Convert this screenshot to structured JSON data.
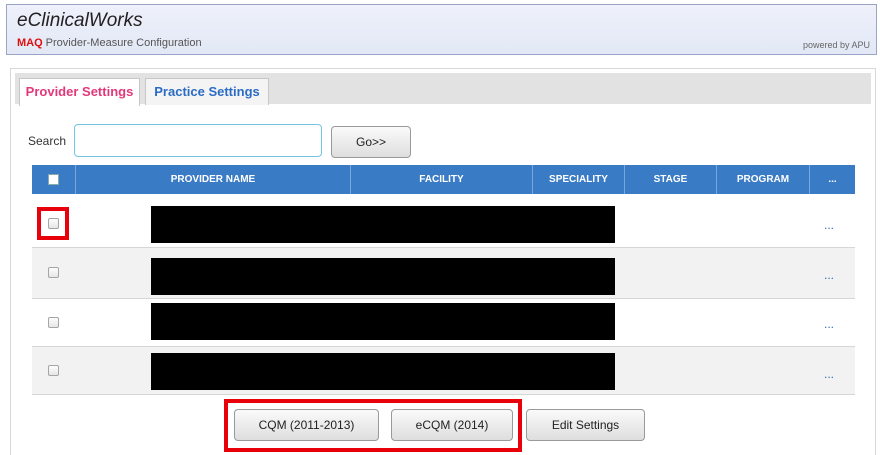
{
  "header": {
    "app_title": "eClinicalWorks",
    "subtitle_prefix": "MAQ",
    "subtitle": "Provider-Measure Configuration",
    "powered_by": "powered by APU"
  },
  "tabs": [
    {
      "label": "Provider Settings",
      "active": true
    },
    {
      "label": "Practice Settings",
      "active": false
    }
  ],
  "search": {
    "label": "Search",
    "value": "",
    "placeholder": "",
    "go_label": "Go>>"
  },
  "table": {
    "columns": [
      "PROVIDER NAME",
      "FACILITY",
      "SPECIALITY",
      "STAGE",
      "PROGRAM",
      "..."
    ],
    "rows": [
      {
        "checked": false,
        "highlighted": true,
        "more": "..."
      },
      {
        "checked": false,
        "highlighted": false,
        "more": "..."
      },
      {
        "checked": false,
        "highlighted": false,
        "more": "..."
      },
      {
        "checked": false,
        "highlighted": false,
        "more": "..."
      }
    ]
  },
  "actions": {
    "cqm_label": "CQM (2011-2013)",
    "ecqm_label": "eCQM (2014)",
    "edit_label": "Edit Settings"
  },
  "colors": {
    "header_bar": "#3a7bc6",
    "active_tab": "#e23878",
    "inactive_tab": "#2b6cc4",
    "highlight": "#e8000b",
    "brand_accent": "#d11111"
  }
}
